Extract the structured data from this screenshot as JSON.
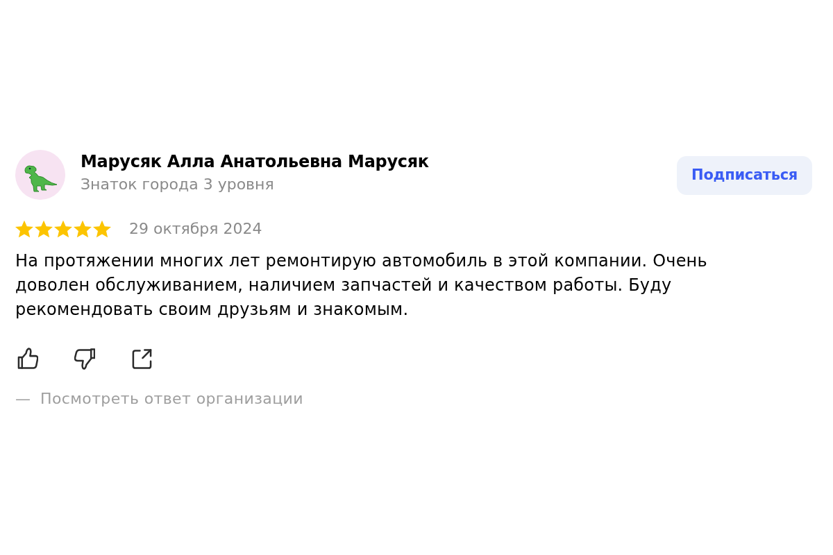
{
  "review": {
    "author": {
      "name": "Марусяк Алла Анатольевна Марусяк",
      "subtitle": "Знаток города 3 уровня"
    },
    "subscribe_button": "Подписаться",
    "stars": 5,
    "date": "29 октября 2024",
    "text": "На протяжении многих лет ремонтирую автомобиль в этой компании. Очень доволен обслуживанием, наличием запчастей и качеством работы. Буду рекомендовать своим друзьям и знакомым.",
    "actions": [
      {
        "kind": "like"
      },
      {
        "kind": "dislike"
      },
      {
        "kind": "share"
      }
    ],
    "response_toggle": {
      "marker": "—",
      "label": "Посмотреть ответ организации"
    }
  }
}
